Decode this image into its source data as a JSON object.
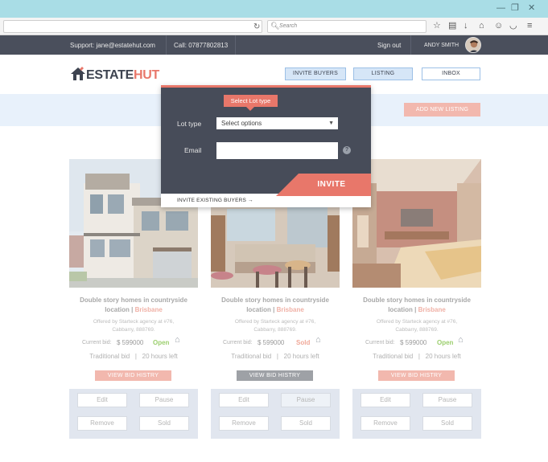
{
  "browser": {
    "search_placeholder": "Search",
    "reload_icon": "↻",
    "window_buttons": [
      "—",
      "❐",
      "✕"
    ]
  },
  "topbar": {
    "support": "Support: jane@estatehut.com",
    "call": "Call: 07877802813",
    "sign_out": "Sign out",
    "user_name": "ANDY SMITH"
  },
  "brand": {
    "logo_left": "ESTATE",
    "logo_right": "HUT"
  },
  "nav": {
    "invite_buyers": "INVITE BUYERS",
    "listing": "LISTING",
    "inbox": "INBOX"
  },
  "band": {
    "add_new_listing": "ADD NEW LISTING"
  },
  "popover": {
    "tip": "Select Lot type",
    "lot_type_label": "Lot type",
    "lot_type_value": "Select options",
    "email_label": "Email",
    "email_value": "",
    "help": "?",
    "invite": "INVITE",
    "invite_existing": "INVITE EXISTING BUYERS  →"
  },
  "colors": {
    "accent": "#e8776a",
    "dark": "#474c59",
    "open": "#9ccf6e",
    "sold": "#f0a898",
    "band": "#e8f1fb"
  },
  "cards": [
    {
      "title": "Double story homes in countryside",
      "location_prefix": "location | ",
      "location": "Brisbane",
      "offer_line1": "Offered by Starteck agency at #76,",
      "offer_line2": "Cabbarry, 888769.",
      "current_bid_label": "Current bid:",
      "current_bid_value": "$ 599000",
      "status": "Open",
      "traditional": "Traditional bid   |   20 hours left",
      "view_bid": "VIEW BID HISTRY",
      "actions": {
        "edit": "Edit",
        "pause": "Pause",
        "remove": "Remove",
        "sold": "Sold"
      }
    },
    {
      "title": "Double story homes in countryside",
      "location_prefix": "location | ",
      "location": "Brisbane",
      "offer_line1": "Offered by Starteck agency at #76,",
      "offer_line2": "Cabbarry, 888769.",
      "current_bid_label": "Current bid:",
      "current_bid_value": "$ 599000",
      "status": "Sold",
      "traditional": "Traditional bid   |   20 hours left",
      "view_bid": "VIEW BID HISTRY",
      "actions": {
        "edit": "Edit",
        "pause": "Pause",
        "remove": "Remove",
        "sold": "Sold"
      }
    },
    {
      "title": "Double story homes in countryside",
      "location_prefix": "location | ",
      "location": "Brisbane",
      "offer_line1": "Offered by Starteck agency at #76,",
      "offer_line2": "Cabbarry, 888769.",
      "current_bid_label": "Current bid:",
      "current_bid_value": "$ 599000",
      "status": "Open",
      "traditional": "Traditional bid   |   20 hours left",
      "view_bid": "VIEW BID HISTRY",
      "actions": {
        "edit": "Edit",
        "pause": "Pause",
        "remove": "Remove",
        "sold": "Sold"
      }
    }
  ]
}
